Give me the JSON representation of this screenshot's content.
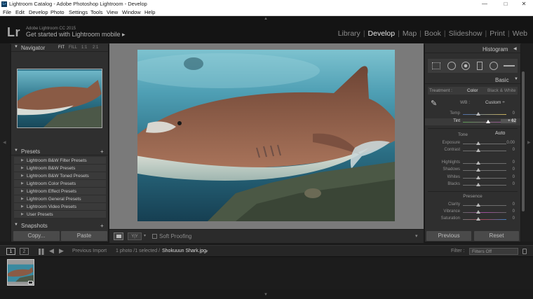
{
  "window": {
    "title": "Lightroom Catalog - Adobe Photoshop Lightroom - Develop",
    "app_icon": "Lr",
    "minimize": "—",
    "maximize": "□",
    "close": "✕"
  },
  "menu": [
    "File",
    "Edit",
    "Develop",
    "Photo",
    "Settings",
    "Tools",
    "View",
    "Window",
    "Help"
  ],
  "identity": {
    "logo": "Lr",
    "version": "Adobe Lightroom CC 2015",
    "mobile": "Get started with Lightroom mobile ▸"
  },
  "modules": [
    "Library",
    "Develop",
    "Map",
    "Book",
    "Slideshow",
    "Print",
    "Web"
  ],
  "active_module": "Develop",
  "navigator": {
    "title": "Navigator",
    "zoom_options": [
      "FIT",
      "FILL",
      "1:1",
      "2:1"
    ]
  },
  "presets": {
    "title": "Presets",
    "add": "+",
    "items": [
      "Lightroom B&W Filter Presets",
      "Lightroom B&W Presets",
      "Lightroom B&W Toned Presets",
      "Lightroom Color Presets",
      "Lightroom Effect Presets",
      "Lightroom General Presets",
      "Lightroom Video Presets",
      "User Presets"
    ]
  },
  "snapshots": {
    "title": "Snapshots",
    "add": "+"
  },
  "left_buttons": {
    "copy": "Copy...",
    "paste": "Paste"
  },
  "toolbar": {
    "soft_proofing": "Soft Proofing",
    "yy": "Y|Y",
    "dropdown": "▾"
  },
  "histogram": {
    "title": "Histogram"
  },
  "basic": {
    "title": "Basic",
    "treatment_label": "Treatment :",
    "treatment_color": "Color",
    "treatment_bw": "Black & White",
    "wb_label": "WB :",
    "wb_value": "Custom ÷",
    "temp": {
      "label": "Temp",
      "value": "0"
    },
    "tint": {
      "label": "Tint",
      "value": "+ 62"
    },
    "tone_label": "Tone",
    "auto": "Auto",
    "tone_sliders": [
      {
        "label": "Exposure",
        "value": "0.00"
      },
      {
        "label": "Contrast",
        "value": "0"
      },
      {
        "label": "Highlights",
        "value": "0"
      },
      {
        "label": "Shadows",
        "value": "0"
      },
      {
        "label": "Whites",
        "value": "0"
      },
      {
        "label": "Blacks",
        "value": "0"
      }
    ],
    "presence_label": "Presence",
    "presence_sliders": [
      {
        "label": "Clarity",
        "value": "0"
      },
      {
        "label": "Vibrance",
        "value": "0"
      },
      {
        "label": "Saturation",
        "value": "0"
      }
    ]
  },
  "right_buttons": {
    "previous": "Previous",
    "reset": "Reset"
  },
  "filmbar": {
    "page1": "1",
    "page2": "2",
    "source": "Previous Import",
    "selection": "1 photo /1 selected /",
    "filename": "Shokuuun Shark.jpg",
    "filename_suffix": " ▾",
    "filter_label": "Filter :",
    "filter_value": "Filters Off"
  }
}
